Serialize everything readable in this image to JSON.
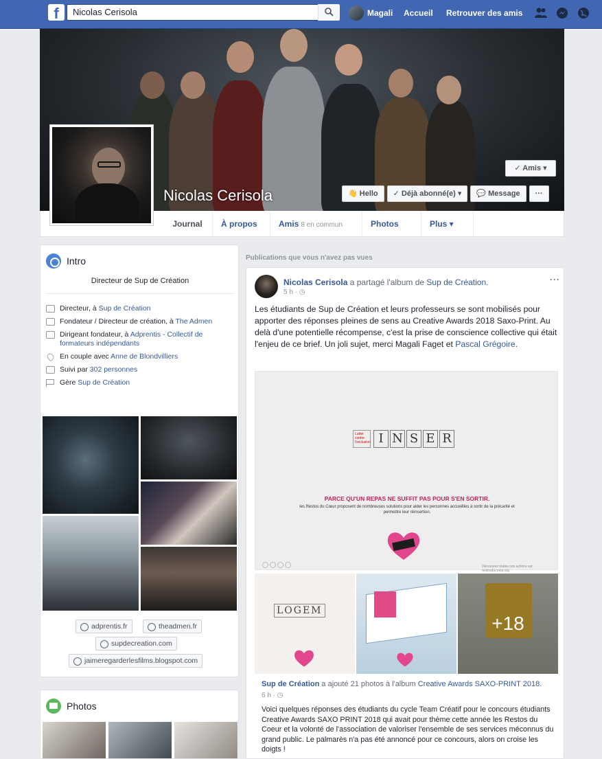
{
  "topbar": {
    "search_value": "Nicolas Cerisola",
    "user_name": "Magali",
    "nav_home": "Accueil",
    "nav_find_friends": "Retrouver des amis"
  },
  "profile": {
    "name": "Nicolas Cerisola",
    "friends_button": "✓ Amis ▾",
    "actions": [
      "👋 Hello",
      "✓ Déjà abonné(e) ▾",
      "💬 Message",
      "···"
    ]
  },
  "tabs": [
    {
      "label": "Journal",
      "sub": ""
    },
    {
      "label": "À propos",
      "sub": ""
    },
    {
      "label": "Amis",
      "sub": "8 en commun"
    },
    {
      "label": "Photos",
      "sub": ""
    },
    {
      "label": "Plus ▾",
      "sub": ""
    }
  ],
  "intro": {
    "title": "Intro",
    "bio": "Directeur de Sup de Création",
    "items": [
      {
        "pre": "Directeur, à ",
        "link": "Sup de Création"
      },
      {
        "pre": "Fondateur / Directeur de création, à ",
        "link": "The Admen"
      },
      {
        "pre": "Dirigeant fondateur, à ",
        "link": "Adprentis - Collectif de formateurs indépendants"
      },
      {
        "pre": "En couple avec ",
        "link": "Anne de Blondvilliers"
      },
      {
        "pre": "Suivi par ",
        "link": "302 personnes"
      },
      {
        "pre": "Gère ",
        "link": "Sup de Création"
      }
    ],
    "links": [
      "adprentis.fr",
      "theadmen.fr",
      "supdecreation.com",
      "jaimeregarderlesfilms.blogspot.com"
    ]
  },
  "photos_card": {
    "title": "Photos"
  },
  "feed": {
    "section_label": "Publications que vous n'avez pas vues",
    "post": {
      "author": "Nicolas Cerisola",
      "verb": " a partagé l'album de ",
      "target": "Sup de Création.",
      "time": "5 h · ◷",
      "more": "···",
      "body_text": "Les étudiants de Sup de Création et leurs professeurs se sont mobilisés pour apporter des réponses pleines de sens au Creative Awards 2018 Saxo-Print. Au delà d'une potentielle récompense, c'est la prise de conscience collective qui était l'enjeu de ce brief. Un joli sujet, merci Magali Faget et ",
      "body_link": "Pascal Grégoire",
      "body_end": ".",
      "image": {
        "small_label": "Lutter contre l'exclusion",
        "word_letters": [
          "I",
          "N",
          "S",
          "E",
          "R"
        ],
        "tagline": "PARCE QU'UN REPAS NE SUFFIT PAS POUR S'EN SORTIR.",
        "subtag": "les Restos du Cœur proposent de nombreuses solutions pour aider les personnes accueillies à sortir de la précarité et permettre leur réinsertion.",
        "bottom_right": "Découvrez toutes nos actions sur restosducoeur.org"
      },
      "thumb1_word": "LOGEM",
      "more_count": "+18",
      "shared": {
        "author": "Sup de Création",
        "verb": " a ajouté 21 photos à l'album ",
        "album": "Creative Awards SAXO-PRINT 2018.",
        "time": "6 h · ◷",
        "text": "Voici quelques réponses des étudiants du cycle Team Créatif pour le concours étudiants Creative Awards SAXO PRINT 2018 qui avait pour thème cette année les Restos du Coeur et la volonté de l'association de valoriser l'ensemble de ses services méconnus du grand public. Le palmarès n'a pas été annoncé pour ce concours, alors on croise les doigts !"
      }
    }
  }
}
